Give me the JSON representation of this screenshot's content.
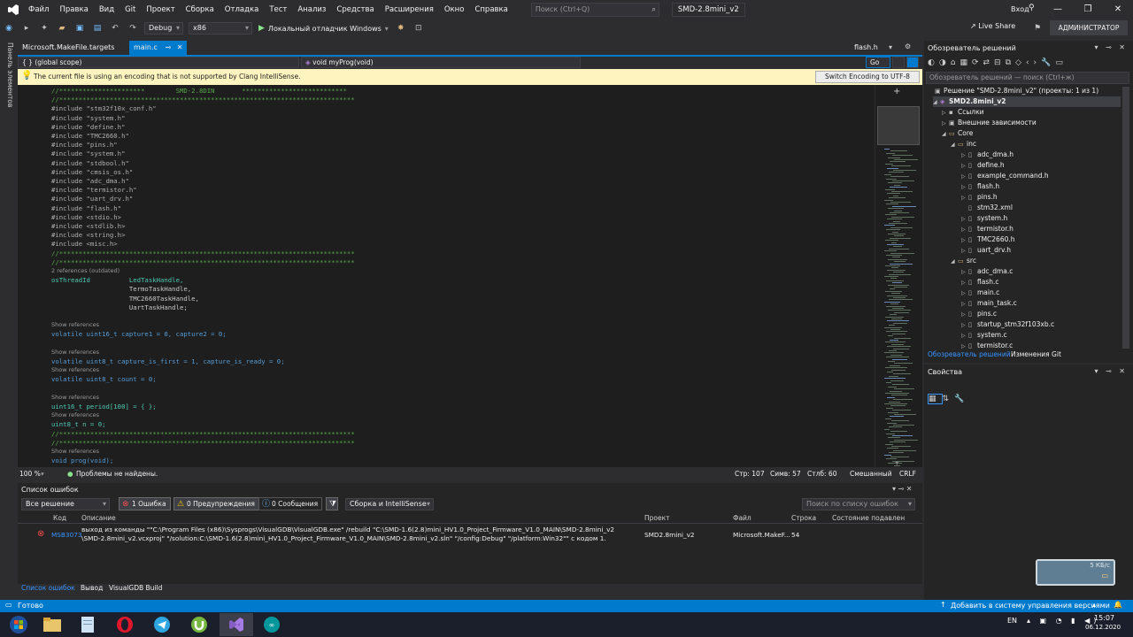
{
  "menu": {
    "items": [
      "Файл",
      "Правка",
      "Вид",
      "Git",
      "Проект",
      "Сборка",
      "Отладка",
      "Тест",
      "Анализ",
      "Средства",
      "Расширения",
      "Окно",
      "Справка"
    ],
    "search_placeholder": "Поиск (Ctrl+Q)",
    "solution_name": "SMD-2.8mini_v2",
    "login": "Вход"
  },
  "toolbar": {
    "config": "Debug",
    "platform": "x86",
    "run_label": "Локальный отладчик Windows",
    "live_share": "Live Share",
    "admin": "АДМИНИСТРАТОР"
  },
  "left_tab": "Панель элементов",
  "editor_tabs": {
    "file1": "Microsoft.MakeFile.targets",
    "file2": "main.c",
    "file3": "flash.h"
  },
  "navbar": {
    "scope": "(global scope)",
    "func": "void myProg(void)",
    "go": "Go"
  },
  "infobar": {
    "message": "The current file is using an encoding that is not supported by Clang IntelliSense.",
    "button": "Switch Encoding to UTF-8"
  },
  "code": {
    "lines": [
      {
        "t": "//**********************        SMD-2.8DIN       ***************************",
        "c": "cmt"
      },
      {
        "t": "//****************************************************************************",
        "c": "cmt"
      },
      {
        "t": "#include \"stm32f10x_conf.h\"",
        "c": "inc"
      },
      {
        "t": "#include \"system.h\"",
        "c": "inc"
      },
      {
        "t": "#include \"define.h\"",
        "c": "inc"
      },
      {
        "t": "#include \"TMC2660.h\"",
        "c": "inc"
      },
      {
        "t": "#include \"pins.h\"",
        "c": "inc"
      },
      {
        "t": "#include \"system.h\"",
        "c": "inc"
      },
      {
        "t": "#include \"stdbool.h\"",
        "c": "inc"
      },
      {
        "t": "#include \"cmsis_os.h\"",
        "c": "inc"
      },
      {
        "t": "#include \"adc_dma.h\"",
        "c": "inc"
      },
      {
        "t": "#include \"termistor.h\"",
        "c": "inc"
      },
      {
        "t": "#include \"uart_drv.h\"",
        "c": "inc"
      },
      {
        "t": "#include \"flash.h\"",
        "c": "inc"
      },
      {
        "t": "#include <stdio.h>",
        "c": "inc"
      },
      {
        "t": "#include <stdlib.h>",
        "c": "inc"
      },
      {
        "t": "#include <string.h>",
        "c": "inc"
      },
      {
        "t": "#include <misc.h>",
        "c": "inc"
      },
      {
        "t": "//****************************************************************************",
        "c": "cmt"
      },
      {
        "t": "//****************************************************************************",
        "c": "cmt"
      },
      {
        "t": "2 references (outdated)",
        "c": "lens"
      },
      {
        "t": "osThreadId          LedTaskHandle,",
        "c": "typ"
      },
      {
        "t": "                    TermoTaskHandle,",
        "c": "plain"
      },
      {
        "t": "                    TMC2660TaskHandle,",
        "c": "plain"
      },
      {
        "t": "                    UartTaskHandle;",
        "c": "plain"
      },
      {
        "t": "",
        "c": "plain"
      },
      {
        "t": "Show references",
        "c": "lens"
      },
      {
        "t": "volatile uint16_t capture1 = 0, capture2 = 0;",
        "c": "kw"
      },
      {
        "t": "",
        "c": "plain"
      },
      {
        "t": "Show references",
        "c": "lens"
      },
      {
        "t": "volatile uint8_t capture_is_first = 1, capture_is_ready = 0;",
        "c": "kw"
      },
      {
        "t": "Show references",
        "c": "lens"
      },
      {
        "t": "volatile uint8_t count = 0;",
        "c": "kw"
      },
      {
        "t": "",
        "c": "plain"
      },
      {
        "t": "Show references",
        "c": "lens"
      },
      {
        "t": "uint16_t period[100] = { };",
        "c": "typ"
      },
      {
        "t": "Show references",
        "c": "lens"
      },
      {
        "t": "uint8_t n = 0;",
        "c": "typ"
      },
      {
        "t": "//****************************************************************************",
        "c": "cmt"
      },
      {
        "t": "//****************************************************************************",
        "c": "cmt"
      },
      {
        "t": "Show references",
        "c": "lens"
      },
      {
        "t": "void prog(void);",
        "c": "kw"
      }
    ]
  },
  "editor_status": {
    "zoom": "100 %",
    "problems": "Проблемы не найдены.",
    "line": "Стр: 107",
    "col": "Симв: 57",
    "pos": "Стлб: 60",
    "mixed": "Смешанный",
    "eol": "CRLF"
  },
  "error_list": {
    "title": "Список ошибок",
    "scope": "Все решение",
    "errors": "1 Ошибка",
    "warnings": "0 Предупреждения",
    "messages": "0 Сообщения",
    "build_filter": "Сборка и IntelliSense",
    "search_placeholder": "Поиск по списку ошибок",
    "columns": [
      "Код",
      "Описание",
      "Проект",
      "Файл",
      "Строка",
      "Состояние подавлен"
    ],
    "row": {
      "code": "MSB3073",
      "desc1": "выход из команды \"\"C:\\Program Files (x86)\\Sysprogs\\VisualGDB\\VisualGDB.exe\" /rebuild \"C:\\SMD-1.6(2.8)mini_HV1.0_Project_Firmware_V1.0_MAIN\\SMD-2.8mini_v2",
      "desc2": "\\SMD-2.8mini_v2.vcxproj\" \"/solution:C:\\SMD-1.6(2.8)mini_HV1.0_Project_Firmware_V1.0_MAIN\\SMD-2.8mini_v2.sln\" \"/config:Debug\" \"/platform:Win32\"\" с кодом 1.",
      "project": "SMD2.8mini_v2",
      "file": "Microsoft.MakeF...",
      "line": "54"
    },
    "tabs": [
      "Список ошибок",
      "Вывод",
      "VisualGDB Build"
    ]
  },
  "solution_explorer": {
    "title": "Обозреватель решений",
    "search": "Обозреватель решений — поиск (Ctrl+ж)",
    "solution": "Решение \"SMD-2.8mini_v2\" (проекты: 1 из 1)",
    "project": "SMD2.8mini_v2",
    "nodes": {
      "refs": "Ссылки",
      "ext": "Внешние зависимости",
      "core": "Core",
      "inc": "inc",
      "src": "src"
    },
    "inc_files": [
      "adc_dma.h",
      "define.h",
      "example_command.h",
      "flash.h",
      "pins.h",
      "stm32.xml",
      "system.h",
      "termistor.h",
      "TMC2660.h",
      "uart_drv.h"
    ],
    "src_files": [
      "adc_dma.c",
      "flash.c",
      "main.c",
      "main_task.c",
      "pins.c",
      "startup_stm32f103xb.c",
      "system.c",
      "termistor.c"
    ],
    "tabs": [
      "Обозреватель решений",
      "Изменения Git"
    ]
  },
  "properties": {
    "title": "Свойства"
  },
  "statusbar": {
    "ready": "Готово",
    "vcs": "Добавить в систему управления версиями"
  },
  "taskbar": {
    "lang": "EN",
    "time": "15:07",
    "date": "06.12.2020"
  },
  "toast": {
    "text": "5 КБ/с"
  }
}
